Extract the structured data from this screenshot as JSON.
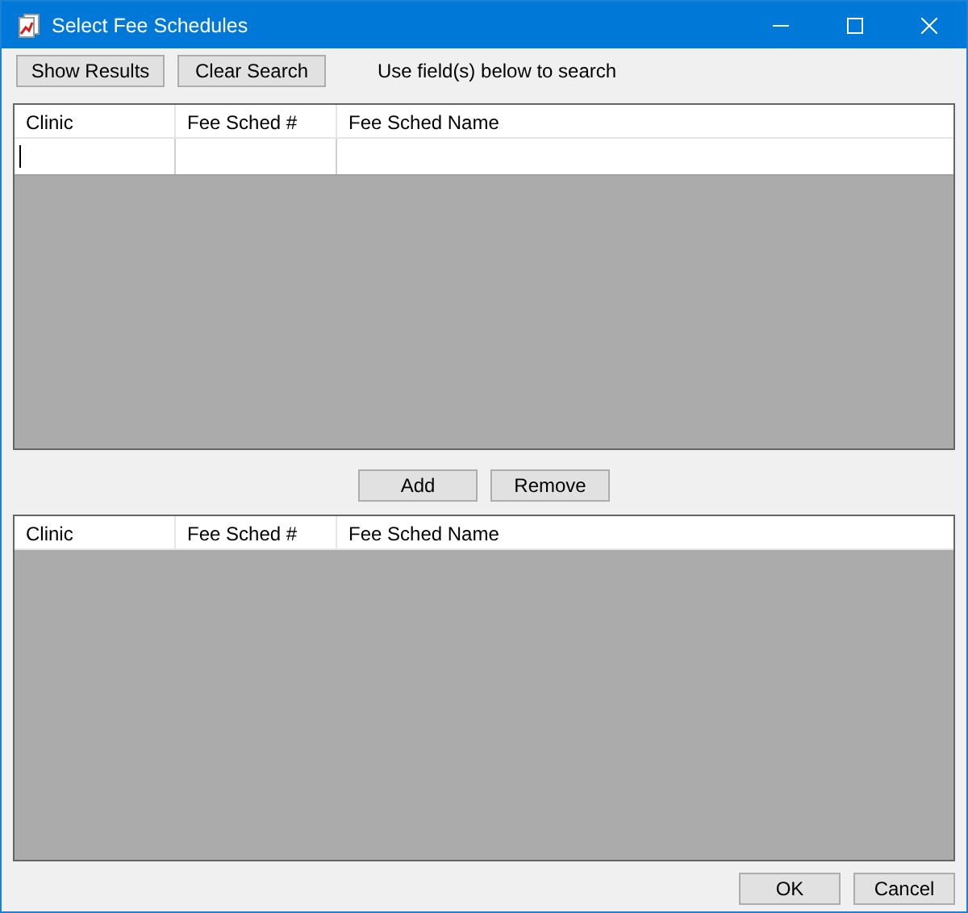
{
  "window": {
    "title": "Select Fee Schedules"
  },
  "toolbar": {
    "buttons": [
      "Show Results",
      "Clear Search"
    ],
    "hint": "Use field(s) below to search"
  },
  "search_grid": {
    "columns": [
      "Clinic",
      "Fee Sched #",
      "Fee Sched Name"
    ],
    "filter_row": [
      {
        "focused": true
      },
      {
        "focused": false
      },
      {
        "focused": false
      }
    ]
  },
  "middle_buttons": [
    "Add",
    "Remove"
  ],
  "selected_grid": {
    "columns": [
      "Clinic",
      "Fee Sched #",
      "Fee Sched Name"
    ]
  },
  "footer_buttons": [
    "OK",
    "Cancel"
  ]
}
